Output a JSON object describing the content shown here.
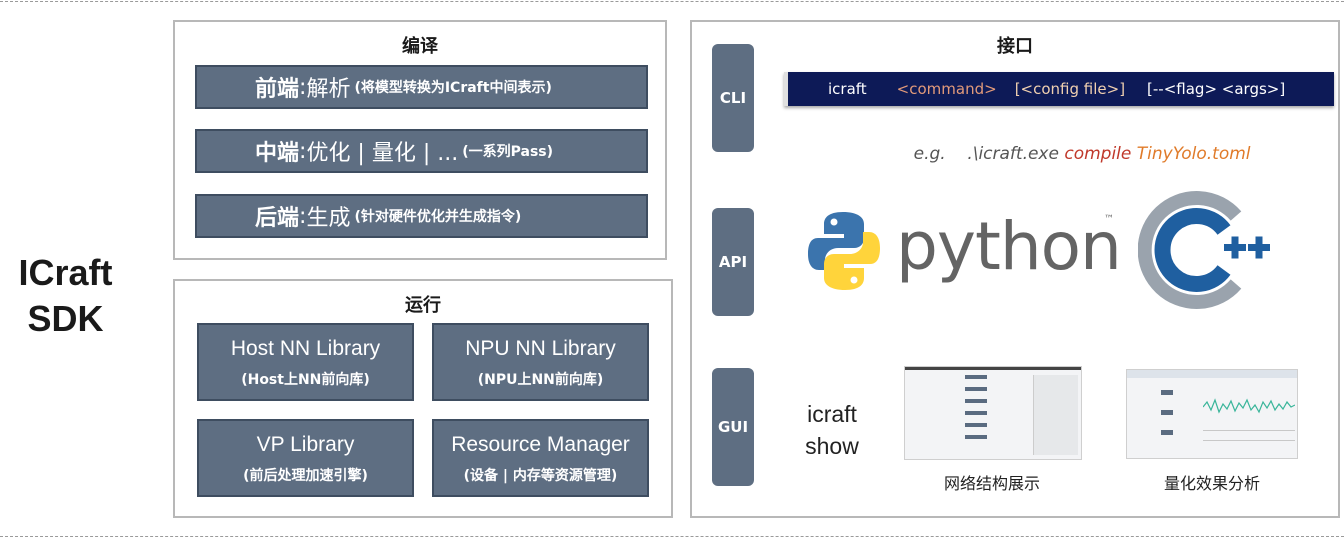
{
  "sdk": {
    "line1": "ICraft",
    "line2": "SDK"
  },
  "compile": {
    "title": "编译",
    "rows": [
      {
        "head": "前端",
        "sep": ":",
        "main": "解析",
        "note": "(将模型转换为ICraft中间表示)"
      },
      {
        "head": "中端",
        "sep": ":",
        "main": "优化 | 量化 | ...",
        "note": "(一系列Pass)"
      },
      {
        "head": "后端",
        "sep": ":",
        "main": "生成",
        "note": "(针对硬件优化并生成指令)"
      }
    ]
  },
  "runtime": {
    "title": "运行",
    "libs": [
      {
        "name": "Host NN Library",
        "desc": "(Host上NN前向库)"
      },
      {
        "name": "NPU NN Library",
        "desc": "(NPU上NN前向库)"
      },
      {
        "name": "VP Library",
        "desc": "(前后处理加速引擎)"
      },
      {
        "name": "Resource Manager",
        "desc": "(设备 | 内存等资源管理)"
      }
    ]
  },
  "interface": {
    "title": "接口",
    "cli": {
      "label": "CLI",
      "cmd": "icraft",
      "command": "<command>",
      "config": "[<config file>]",
      "flags": "[--<flag> <args>]",
      "eg_prefix": "e.g.",
      "eg_path": ".\\icraft.exe",
      "eg_cmd": "compile",
      "eg_file": "TinyYolo.toml"
    },
    "api": {
      "label": "API",
      "python_text": "python",
      "tm": "™"
    },
    "gui": {
      "label": "GUI",
      "show_line1": "icraft",
      "show_line2": "show",
      "caption1": "网络结构展示",
      "caption2": "量化效果分析"
    }
  },
  "colors": {
    "box": "#5e6e82",
    "cmd_bg": "#0d1a57",
    "python_blue": "#3b74ad",
    "python_yellow": "#ffd43b",
    "cpp_blue": "#1f5fa0"
  }
}
